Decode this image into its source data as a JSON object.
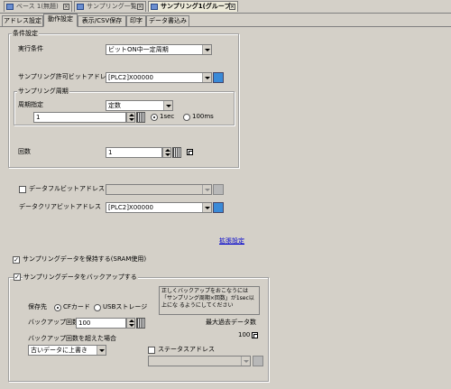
{
  "doc_tabs": [
    {
      "label": "ベース 1(無題)"
    },
    {
      "label": "サンプリング一覧"
    },
    {
      "label": "サンプリング1(グループ"
    }
  ],
  "tabs": [
    {
      "label": "アドレス設定"
    },
    {
      "label": "動作設定"
    },
    {
      "label": "表示/CSV保存"
    },
    {
      "label": "印字"
    },
    {
      "label": "データ書込み"
    }
  ],
  "condition": {
    "group_title": "条件設定",
    "exec_label": "実行条件",
    "exec_value": "ビットON中一定周期",
    "permit_label": "サンプリング許可ビットアドレス",
    "permit_value": "[PLC2]X00000",
    "period_group_title": "サンプリング周期",
    "period_spec_label": "周期指定",
    "period_spec_value": "定数",
    "period_value": "1",
    "unit_1sec": "1sec",
    "unit_100ms": "100ms",
    "count_label": "回数",
    "count_value": "1"
  },
  "data_full_label": "データフルビットアドレス",
  "data_clear_label": "データクリアビットアドレス",
  "data_clear_value": "[PLC2]X00000",
  "extended_link": "拡張設定",
  "keep_label": "サンプリングデータを保持する(SRAM使用)",
  "backup": {
    "title": "サンプリングデータをバックアップする",
    "dest_label": "保存先",
    "cf_label": "CFカード",
    "usb_label": "USBストレージ",
    "note": "正しくバックアップをおこなうには「サンプリング周期×回数」が1sec以上にな るようにしてください",
    "count_label": "バックアップ回数",
    "count_value": "100",
    "max_label": "最大過去データ数",
    "max_value": "100",
    "over_label": "バックアップ回数を超えた場合",
    "over_value": "古いデータに上書き",
    "status_label": "ステータスアドレス"
  }
}
